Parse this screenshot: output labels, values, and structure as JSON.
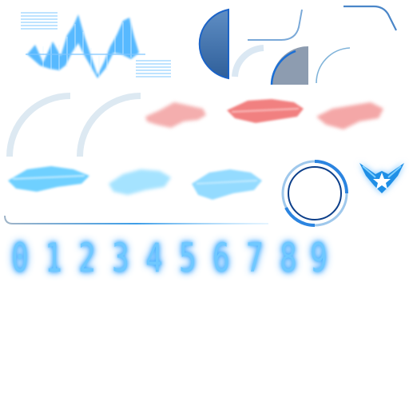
{
  "sprite_sheet": {
    "colors": {
      "hud_blue": "#4fb6ff",
      "hud_cyan": "#56c8ff",
      "hud_dark_blue": "#1a6fd6",
      "panel_blue": "#3f6fa8",
      "panel_gray": "#8a9bb0",
      "ghost_red": "#ef6a6a",
      "ghost_cyan": "#56d6ff",
      "arc_pale": "#d8e7f2"
    },
    "icons": {
      "waveform_panel": "waveform-icon",
      "quarter_panel": "quarter-circle-icon",
      "corner_lines": "corner-line-icon",
      "arc_frames": "arc-frame-icon",
      "ship_ghosts_red": "ship-silhouette-icon",
      "ship_ghosts_blue": "ship-silhouette-icon",
      "ring": "ring-icon",
      "emblem": "winged-star-emblem-icon",
      "divider": "divider-line-icon"
    },
    "digits": [
      "0",
      "1",
      "2",
      "3",
      "4",
      "5",
      "6",
      "7",
      "8",
      "9"
    ]
  }
}
